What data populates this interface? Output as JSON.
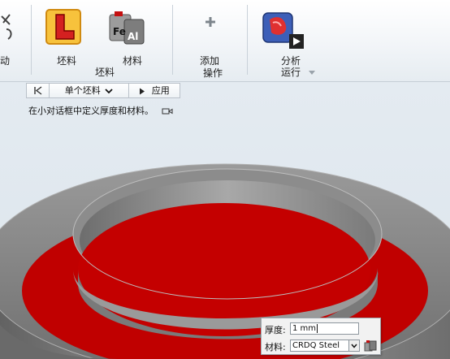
{
  "ribbon": {
    "cut_label": "动",
    "blank_label": "坯料",
    "material_label": "材料",
    "group_blank_label": "坯料",
    "add_label_line1": "添加",
    "add_label_line2": "操作",
    "analyze_label": "分析",
    "run_label": "运行",
    "material_icon_text_fe": "Fe",
    "material_icon_text_al": "Al"
  },
  "strip": {
    "mode_label": "单个坯料",
    "apply_label": "应用"
  },
  "hint": {
    "text": "在小对话框中定义厚度和材料。"
  },
  "mini_dialog": {
    "thickness_label": "厚度:",
    "thickness_value": "1 mm",
    "material_label": "材料:",
    "material_value": "CRDQ Steel"
  },
  "colors": {
    "blank_red": "#c00000",
    "part_gray": "#8a8a8a",
    "accent_orange": "#f0b42a"
  }
}
